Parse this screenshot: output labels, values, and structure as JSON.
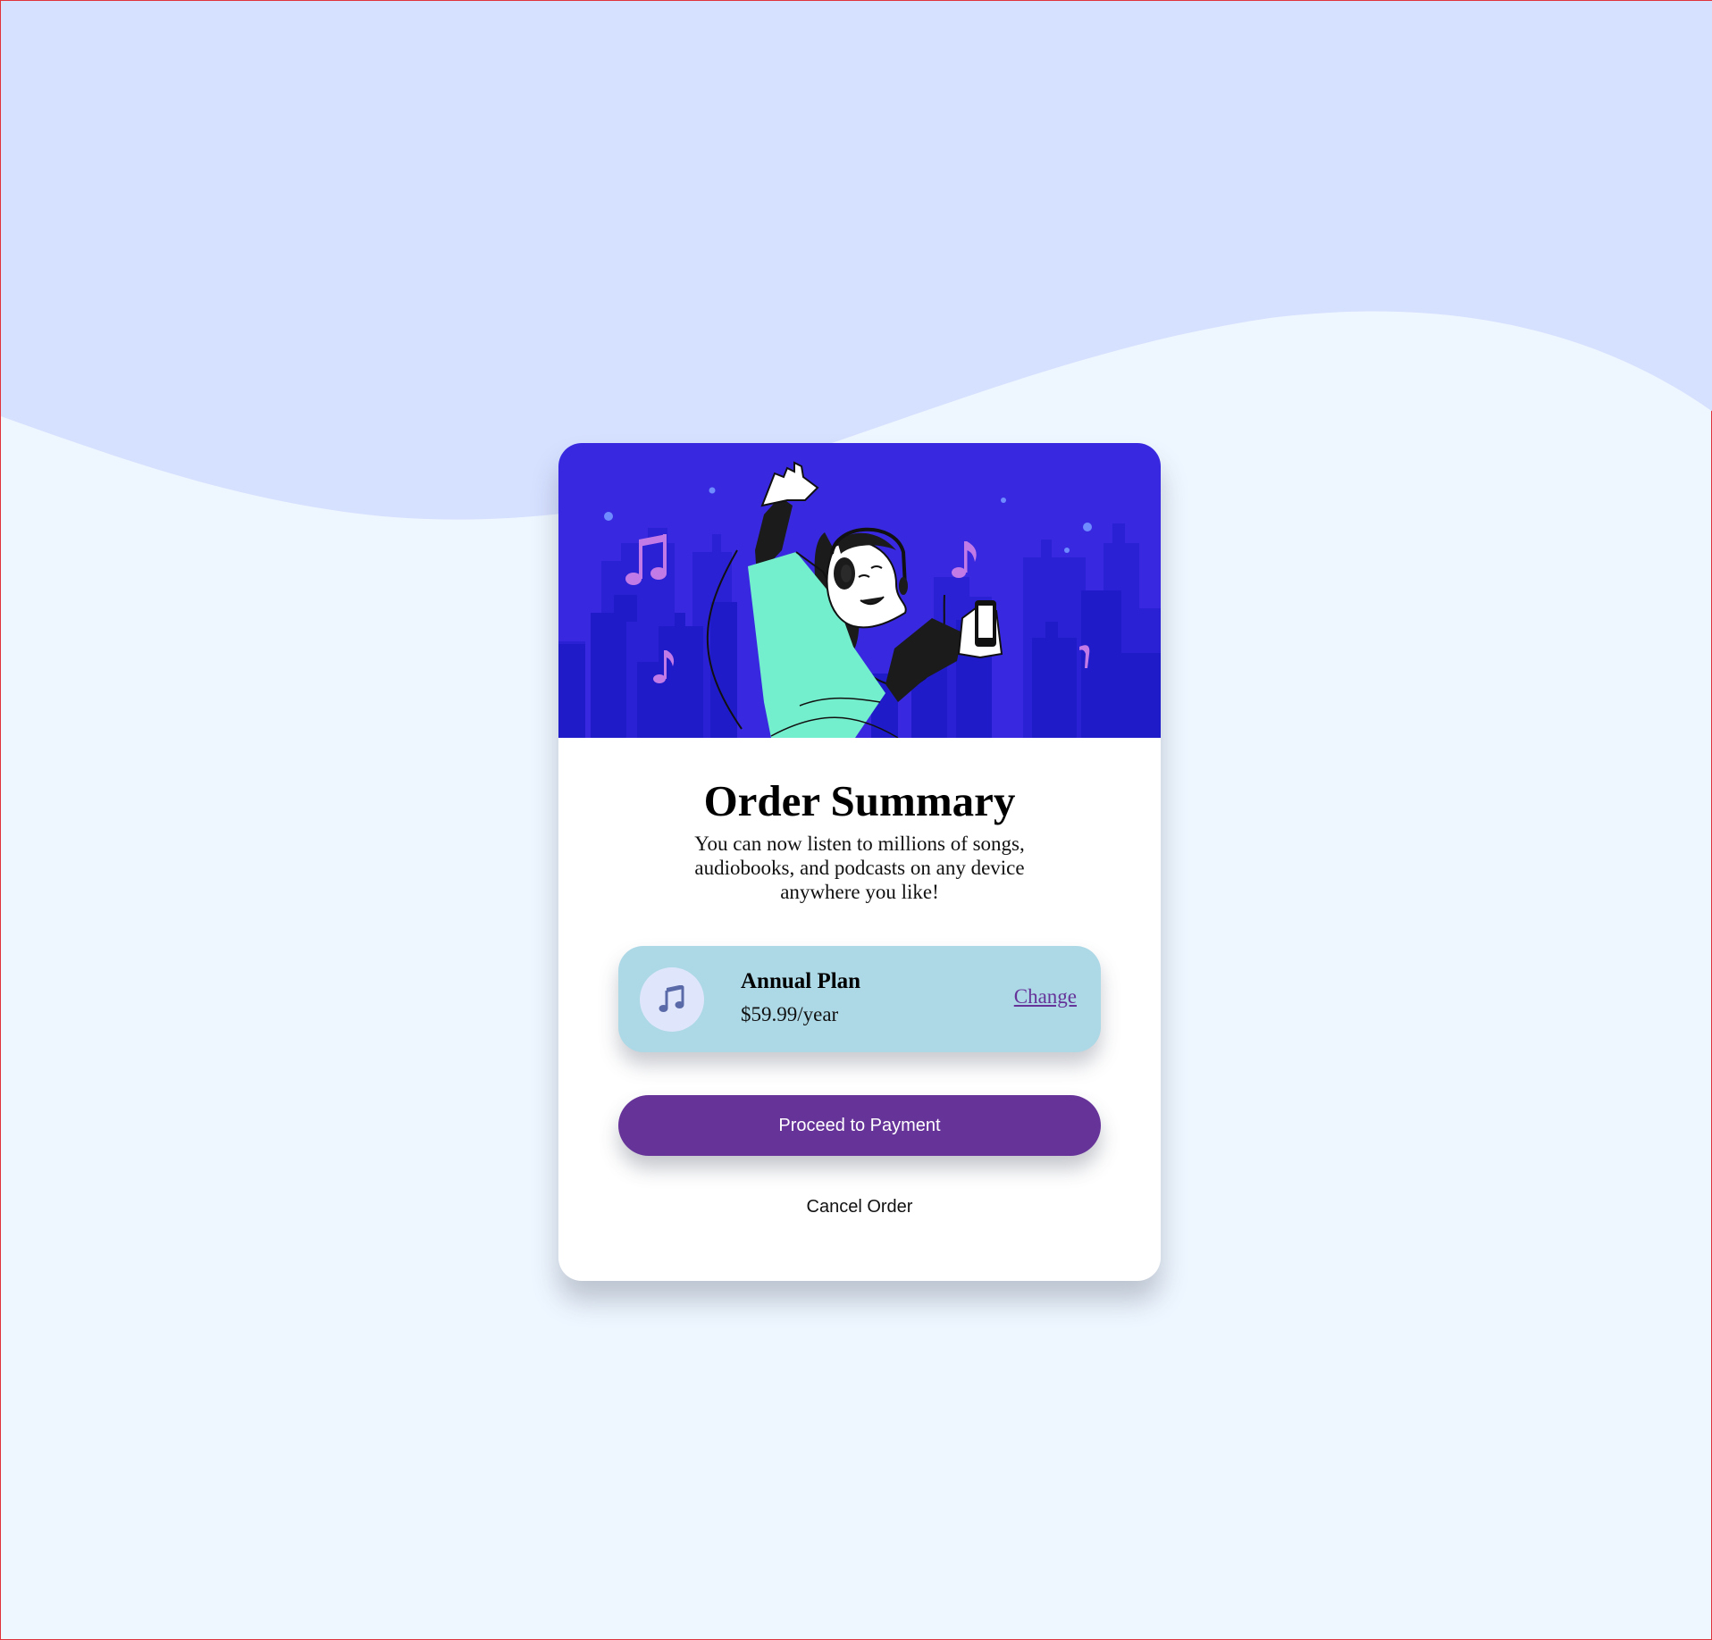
{
  "order": {
    "title": "Order Summary",
    "description": "You can now listen to millions of songs, audiobooks, and podcasts on any device anywhere you like!"
  },
  "plan": {
    "icon": "music-note-icon",
    "name": "Annual Plan",
    "price": "$59.99/year",
    "change_label": "Change"
  },
  "actions": {
    "proceed_label": "Proceed to Payment",
    "cancel_label": "Cancel Order"
  },
  "colors": {
    "page_background": "#eef6ff",
    "wave": "#d6e0ff",
    "hero_background": "#3829e0",
    "accent": "#663399",
    "plan_background": "#add8e6"
  }
}
